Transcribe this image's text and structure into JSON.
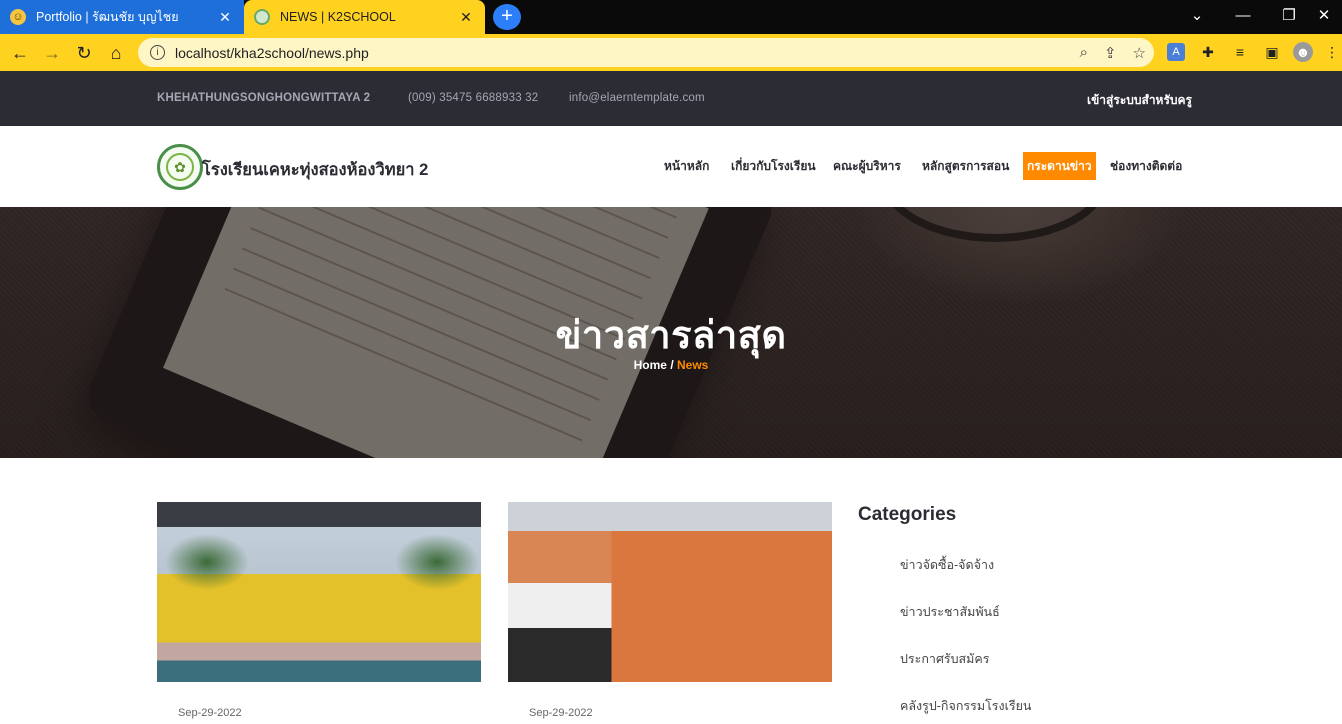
{
  "browser": {
    "tabs": [
      {
        "title": "Portfolio | รัฒนชัย บุญไชย",
        "favicon": "emoji-face-icon",
        "active": false
      },
      {
        "title": "NEWS | K2SCHOOL",
        "favicon": "school-logo-icon",
        "active": true
      }
    ],
    "url": "localhost/kha2school/news.php",
    "colors": {
      "frame": "#ffd21f",
      "inactive_tab": "#1e6fd9"
    }
  },
  "topbar": {
    "school_code": "KHEHATHUNGSONGHONGWITTAYA 2",
    "phone": "(009) 35475 6688933 32",
    "email": "info@elaerntemplate.com",
    "login": "เข้าสู่ระบบสำหรับครู"
  },
  "header": {
    "brand": "โรงเรียนเคหะทุ่งสองห้องวิทยา 2",
    "menu": [
      {
        "label": "หน้าหลัก",
        "active": false
      },
      {
        "label": "เกี่ยวกับโรงเรียน",
        "active": false
      },
      {
        "label": "คณะผู้บริหาร",
        "active": false
      },
      {
        "label": "หลักสูตรการสอน",
        "active": false
      },
      {
        "label": "กระดานข่าว",
        "active": true
      },
      {
        "label": "ช่องทางติดต่อ",
        "active": false
      }
    ],
    "accent": "#ff8a00"
  },
  "hero": {
    "title": "ข่าวสารล่าสุด",
    "breadcrumb_home": "Home",
    "breadcrumb_sep": "/",
    "breadcrumb_current": "News"
  },
  "posts": [
    {
      "date": "Sep-29-2022"
    },
    {
      "date": "Sep-29-2022"
    }
  ],
  "sidebar": {
    "title": "Categories",
    "categories": [
      "ข่าวจัดซื้อ-จัดจ้าง",
      "ข่าวประชาสัมพันธ์",
      "ประกาศรับสมัคร",
      "คลังรูป-กิจกรรมโรงเรียน"
    ]
  }
}
